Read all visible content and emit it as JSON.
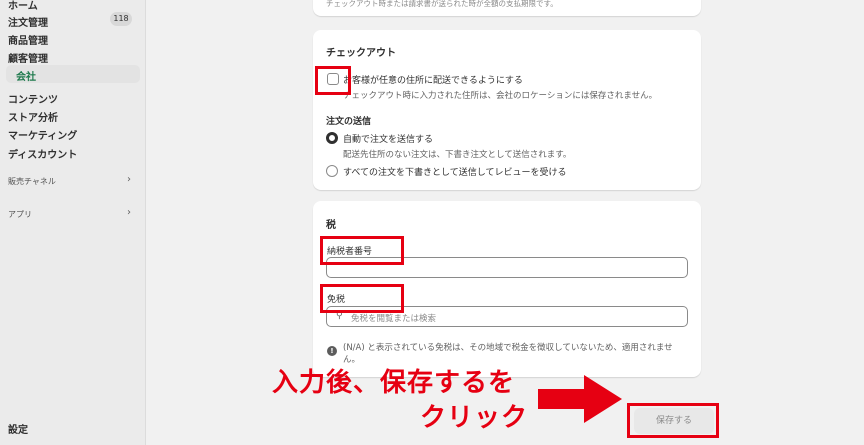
{
  "sidebar": {
    "home": "ホーム",
    "orders": "注文管理",
    "orders_count": "118",
    "products": "商品管理",
    "customers": "顧客管理",
    "companies": "会社",
    "content": "コンテンツ",
    "analytics": "ストア分析",
    "marketing": "マーケティング",
    "discounts": "ディスカウント",
    "sales_channels": "販売チャネル",
    "apps": "アプリ",
    "settings": "設定"
  },
  "top_card": {
    "note": "チェックアウト時または請求書が送られた時が全額の支払期限です。"
  },
  "checkout": {
    "title": "チェックアウト",
    "ship_any_label": "お客様が任意の住所に配送できるようにする",
    "ship_any_help": "チェックアウト時に入力された住所は、会社のロケーションには保存されません。",
    "order_submit_title": "注文の送信",
    "auto_submit_label": "自動で注文を送信する",
    "auto_submit_help": "配送先住所のない注文は、下書き注文として送信されます。",
    "draft_all_label": "すべての注文を下書きとして送信してレビューを受ける"
  },
  "tax": {
    "title": "税",
    "tax_id_label": "納税者番号",
    "tax_id_value": "",
    "exemption_label": "免税",
    "exemption_placeholder": "免税を閲覧または検索",
    "exemption_info_line1": "(N/A) と表示されている免税は、その地域で税金を徴収していないため、適用されませ",
    "exemption_info_line2": "ん。"
  },
  "annotation": {
    "line1": "入力後、保存するを",
    "line2": "クリック",
    "color": "#e60012"
  },
  "save_button": "保存する"
}
